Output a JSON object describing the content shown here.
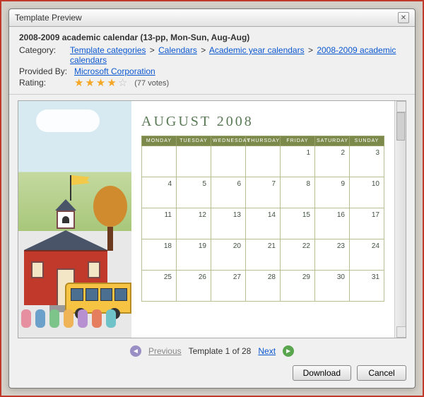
{
  "window": {
    "title": "Template Preview",
    "close": "✕"
  },
  "template": {
    "name": "2008-2009 academic calendar (13-pp, Mon-Sun, Aug-Aug)",
    "category_label": "Category:",
    "breadcrumbs": [
      "Template categories",
      "Calendars",
      "Academic year calendars",
      "2008-2009 academic calendars"
    ],
    "provided_by_label": "Provided By:",
    "provided_by": "Microsoft Corporation",
    "rating_label": "Rating:",
    "votes": "(77 votes)"
  },
  "calendar": {
    "month_title": "AUGUST 2008",
    "days": [
      "MONDAY",
      "TUESDAY",
      "WEDNESDAY",
      "THURSDAY",
      "FRIDAY",
      "SATURDAY",
      "SUNDAY"
    ],
    "rows": [
      [
        "",
        "",
        "",
        "",
        "1",
        "2",
        "3"
      ],
      [
        "4",
        "5",
        "6",
        "7",
        "8",
        "9",
        "10"
      ],
      [
        "11",
        "12",
        "13",
        "14",
        "15",
        "16",
        "17"
      ],
      [
        "18",
        "19",
        "20",
        "21",
        "22",
        "23",
        "24"
      ],
      [
        "25",
        "26",
        "27",
        "28",
        "29",
        "30",
        "31"
      ]
    ]
  },
  "nav": {
    "prev": "Previous",
    "counter": "Template 1 of 28",
    "next": "Next"
  },
  "buttons": {
    "download": "Download",
    "cancel": "Cancel"
  }
}
